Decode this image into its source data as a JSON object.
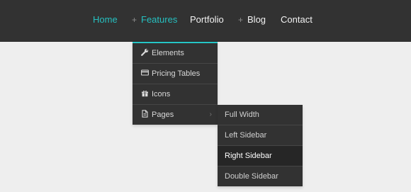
{
  "nav": {
    "home": "Home",
    "features": "Features",
    "portfolio": "Portfolio",
    "blog": "Blog",
    "contact": "Contact",
    "expand_marker": "+"
  },
  "dropdown": {
    "items": [
      {
        "label": "Elements",
        "icon": "wrench-icon"
      },
      {
        "label": "Pricing Tables",
        "icon": "credit-card-icon"
      },
      {
        "label": "Icons",
        "icon": "gift-icon"
      },
      {
        "label": "Pages",
        "icon": "file-icon",
        "chevron": "›"
      }
    ]
  },
  "submenu": {
    "items": [
      {
        "label": "Full Width"
      },
      {
        "label": "Left Sidebar"
      },
      {
        "label": "Right Sidebar",
        "current": true
      },
      {
        "label": "Double Sidebar"
      }
    ]
  },
  "colors": {
    "accent": "#26c0c0",
    "navbar_bg": "#323232",
    "page_bg": "#eeeeee",
    "submenu_active_bg": "#262626"
  }
}
